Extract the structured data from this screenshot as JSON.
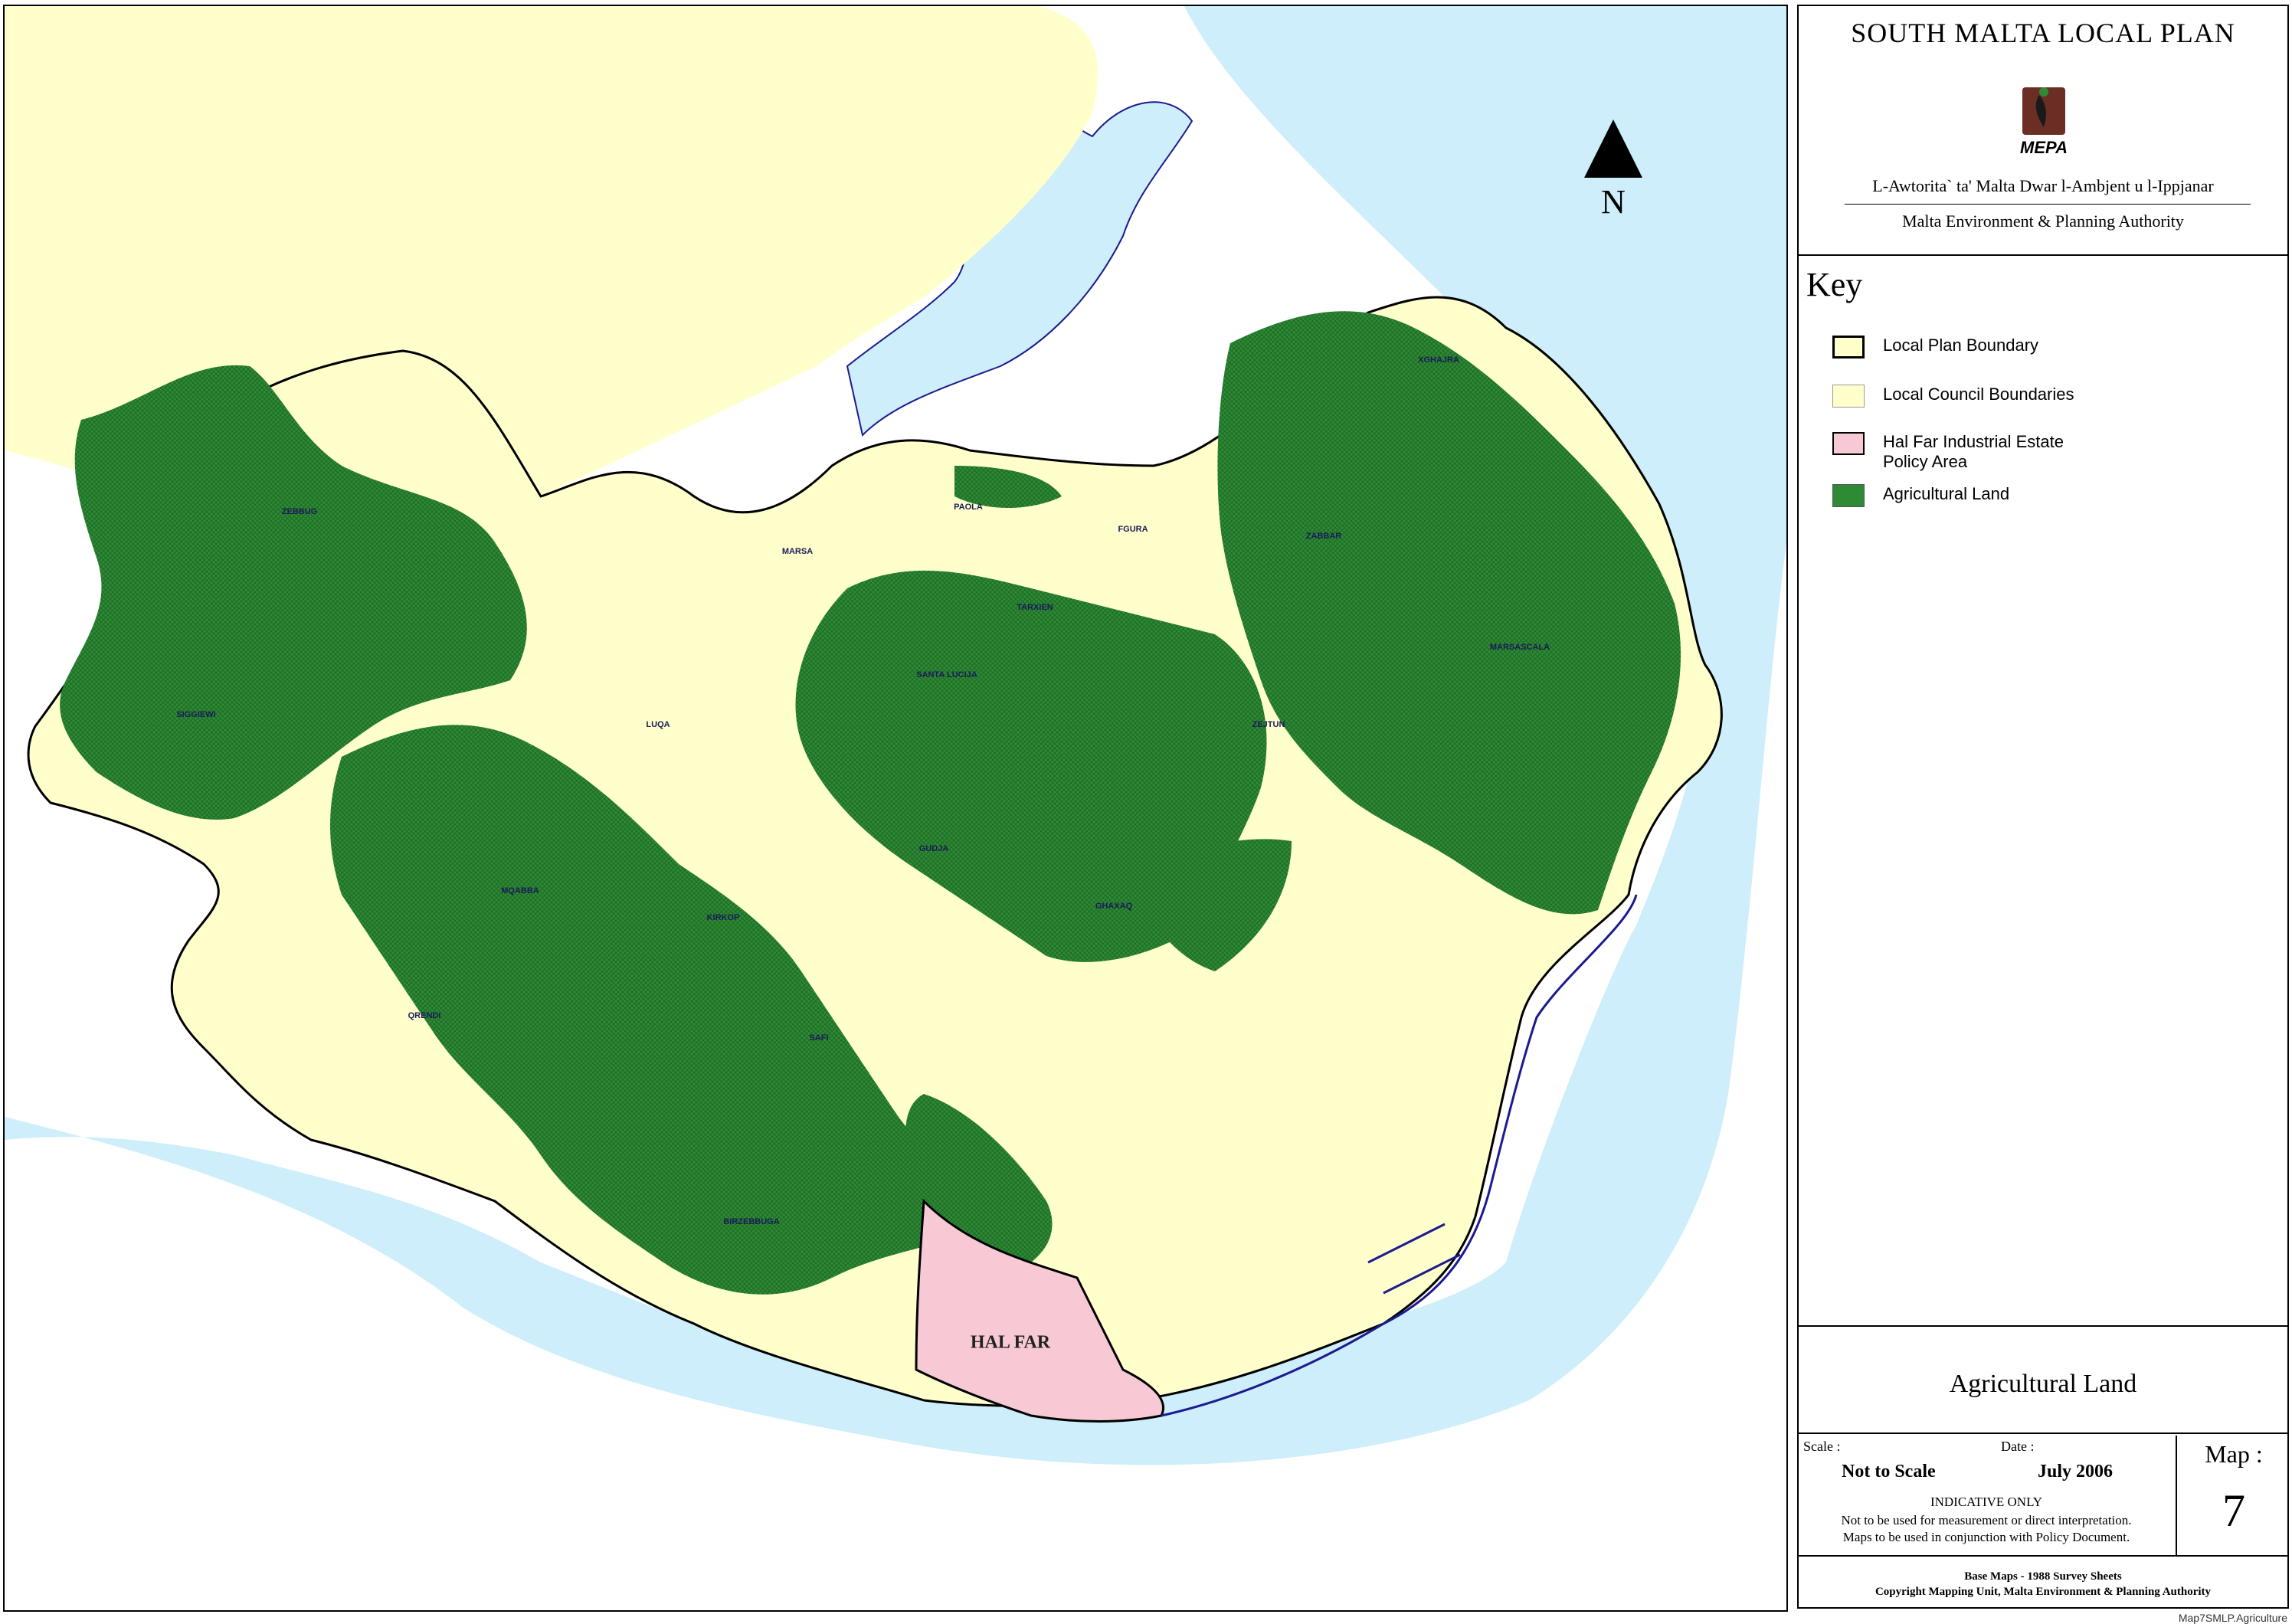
{
  "panel": {
    "title": "SOUTH MALTA LOCAL PLAN",
    "logo_text": "MEPA",
    "org_maltese": "L-Awtorita` ta' Malta Dwar l-Ambjent u l-Ippjanar",
    "org_english": "Malta Environment & Planning Authority",
    "key_title": "Key",
    "key_items": [
      {
        "label": "Local Plan Boundary",
        "color": "#ffffcc"
      },
      {
        "label": "Local Council Boundaries",
        "color": "#ffffcc"
      },
      {
        "label": "Hal Far Industrial Estate\nPolicy Area",
        "color": "#f7c9d4"
      },
      {
        "label": "Agricultural Land",
        "color": "#2f8a36"
      }
    ],
    "map_title": "Agricultural Land",
    "scale_label": "Scale :",
    "scale_value": "Not to Scale",
    "date_label": "Date :",
    "date_value": "July 2006",
    "indicative": "INDICATIVE ONLY",
    "note1": "Not to be used for measurement or direct interpretation.",
    "note2": "Maps to be used in conjunction with Policy Document.",
    "map_label": "Map :",
    "map_number": "7",
    "base_maps": "Base Maps - 1988 Survey Sheets",
    "copyright": "Copyright Mapping Unit, Malta Environment & Planning Authority"
  },
  "map": {
    "north_label": "N",
    "places": [
      "ZEBBUG",
      "SIGGIEWI",
      "MARSA",
      "PAOLA",
      "FGURA",
      "TARXIEN",
      "SANTA LUCIJA",
      "LUQA",
      "XGHAJRA",
      "ZABBAR",
      "MARSASCALA",
      "ZEJTUN",
      "GUDJA",
      "GHAXAQ",
      "MQABBA",
      "KIRKOP",
      "QRENDI",
      "SAFI",
      "BIRZEBBUGA"
    ],
    "hal_far_label": "HAL FAR",
    "colors": {
      "sea": "#cdeefa",
      "land": "#ffffcc",
      "agriculture": "#2f8a36",
      "industrial": "#f7c9d4",
      "coast": "#1b1b8f"
    }
  },
  "file_ref": "Map7SMLP.Agriculture"
}
